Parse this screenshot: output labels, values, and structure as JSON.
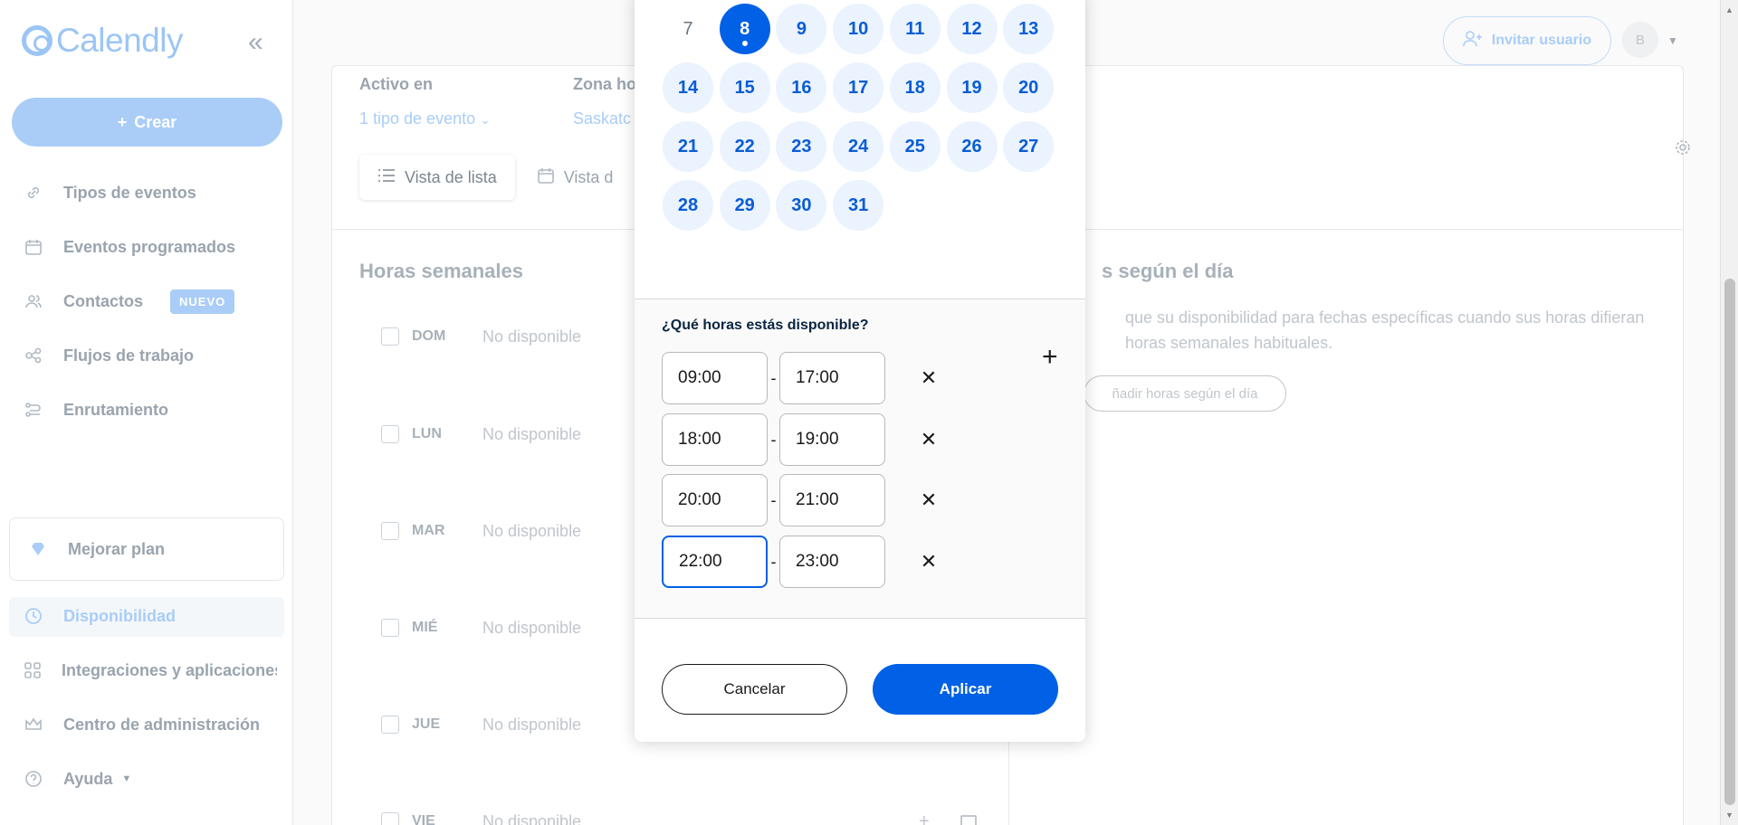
{
  "brand": {
    "name": "Calendly"
  },
  "sidebar": {
    "create_label": "Crear",
    "items": [
      {
        "label": "Tipos de eventos",
        "icon": "link-icon"
      },
      {
        "label": "Eventos programados",
        "icon": "calendar-icon"
      },
      {
        "label": "Contactos",
        "icon": "contacts-icon",
        "badge": "NUEVO"
      },
      {
        "label": "Flujos de trabajo",
        "icon": "workflow-icon"
      },
      {
        "label": "Enrutamiento",
        "icon": "routing-icon"
      }
    ],
    "upgrade_label": "Mejorar plan",
    "bottom_items": [
      {
        "label": "Disponibilidad",
        "icon": "clock-icon",
        "active": true
      },
      {
        "label": "Integraciones y aplicaciones",
        "icon": "apps-icon"
      },
      {
        "label": "Centro de administración",
        "icon": "crown-icon"
      },
      {
        "label": "Ayuda",
        "icon": "help-icon"
      }
    ]
  },
  "header": {
    "invite_label": "Invitar usuario",
    "avatar_initial": "B"
  },
  "schedule": {
    "active_on_label": "Activo en",
    "active_on_value": "1 tipo de evento",
    "timezone_label": "Zona ho",
    "timezone_value": "Saskatc",
    "list_view_label": "Vista de lista",
    "calendar_view_label": "Vista d"
  },
  "weekly": {
    "title": "Horas semanales",
    "days": [
      {
        "name": "DOM",
        "status": "No disponible"
      },
      {
        "name": "LUN",
        "status": "No disponible"
      },
      {
        "name": "MAR",
        "status": "No disponible"
      },
      {
        "name": "MIÉ",
        "status": "No disponible"
      },
      {
        "name": "JUE",
        "status": "No disponible"
      },
      {
        "name": "VIE",
        "status": "No disponible"
      }
    ]
  },
  "date_specific": {
    "title": "s según el día",
    "description": "que su disponibilidad para fechas específicas cuando sus horas difieran\nhoras semanales habituales.",
    "add_label": "ñadir horas según el día"
  },
  "popup": {
    "calendar_days": [
      "7",
      "8",
      "9",
      "10",
      "11",
      "12",
      "13",
      "14",
      "15",
      "16",
      "17",
      "18",
      "19",
      "20",
      "21",
      "22",
      "23",
      "24",
      "25",
      "26",
      "27",
      "28",
      "29",
      "30",
      "31"
    ],
    "selected_day": "8",
    "question": "¿Qué horas estás disponible?",
    "time_ranges": [
      {
        "start": "09:00",
        "end": "17:00"
      },
      {
        "start": "18:00",
        "end": "19:00"
      },
      {
        "start": "20:00",
        "end": "21:00"
      },
      {
        "start": "22:00",
        "end": "23:00"
      }
    ],
    "separator": "-",
    "cancel_label": "Cancelar",
    "apply_label": "Aplicar"
  },
  "colors": {
    "primary": "#0060e6",
    "primary_light": "#a9cdf6",
    "day_bg": "#eaf3fe"
  }
}
